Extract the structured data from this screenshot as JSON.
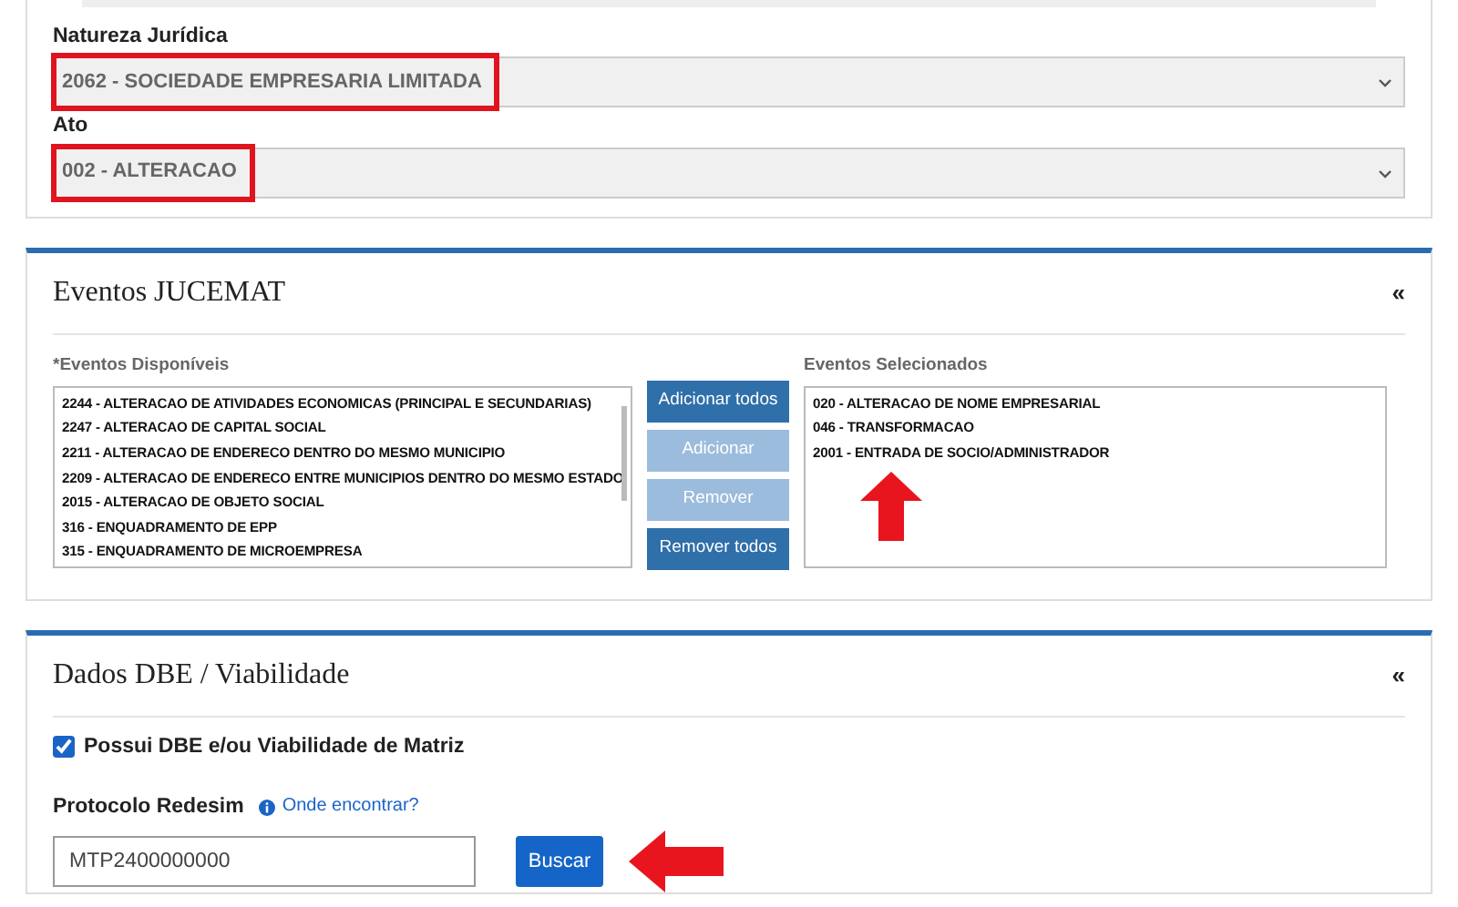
{
  "company": {
    "fields": [
      {
        "label": "Natureza Jurídica",
        "value": "2062 - SOCIEDADE EMPRESARIA LIMITADA",
        "highlighted": true
      },
      {
        "label": "Ato",
        "value": "002 - ALTERACAO",
        "highlighted": true
      }
    ]
  },
  "events": {
    "title": "Eventos JUCEMAT",
    "collapse": "«",
    "available": {
      "label": "*Eventos Disponíveis",
      "items": [
        "2244 - ALTERACAO DE ATIVIDADES ECONOMICAS (PRINCIPAL E SECUNDARIAS)",
        "2247 - ALTERACAO DE CAPITAL SOCIAL",
        "2211 - ALTERACAO DE ENDERECO DENTRO DO MESMO MUNICIPIO",
        "2209 - ALTERACAO DE ENDERECO ENTRE MUNICIPIOS DENTRO DO MESMO ESTADO",
        "2015 - ALTERACAO DE OBJETO SOCIAL",
        "316 - ENQUADRAMENTO DE EPP",
        "315 - ENQUADRAMENTO DE MICROEMPRESA"
      ]
    },
    "buttons": [
      {
        "label": "Adicionar todos",
        "disabled": false
      },
      {
        "label": "Adicionar",
        "disabled": true
      },
      {
        "label": "Remover",
        "disabled": true
      },
      {
        "label": "Remover todos",
        "disabled": false
      }
    ],
    "selected": {
      "label": "Eventos Selecionados",
      "items": [
        "020 - ALTERACAO DE NOME EMPRESARIAL",
        "046 - TRANSFORMACAO",
        "2001 - ENTRADA DE SOCIO/ADMINISTRADOR"
      ],
      "arrow_marked": true
    }
  },
  "dbe": {
    "title": "Dados DBE / Viabilidade",
    "collapse": "«",
    "checkbox": {
      "label": "Possui DBE e/ou Viabilidade de Matriz",
      "checked": true
    },
    "protocol": {
      "label": "Protocolo Redesim",
      "help_link": "Onde encontrar?",
      "value": "MTP2400000000"
    },
    "search_button": {
      "label": "Buscar",
      "arrow_marked": true
    }
  }
}
